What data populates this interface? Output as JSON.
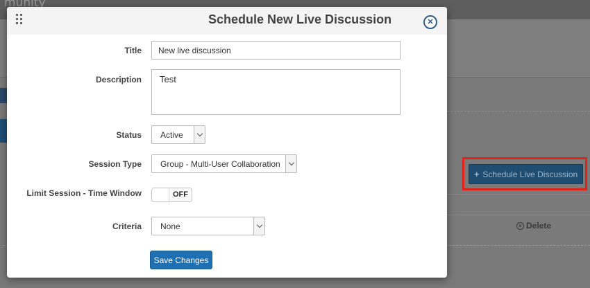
{
  "background": {
    "page_title_fragment": "munity",
    "schedule_button_label": "Schedule Live Discussion",
    "delete_label": "Delete"
  },
  "modal": {
    "title": "Schedule New Live Discussion",
    "fields": {
      "title_label": "Title",
      "title_value": "New live discussion",
      "description_label": "Description",
      "description_value": "Test",
      "status_label": "Status",
      "status_value": "Active",
      "session_type_label": "Session Type",
      "session_type_value": "Group - Multi-User Collaboration",
      "limit_label": "Limit Session - Time Window",
      "limit_toggle_text": "OFF",
      "criteria_label": "Criteria",
      "criteria_value": "None"
    },
    "save_label": "Save Changes"
  },
  "colors": {
    "primary": "#1f6fb3",
    "highlight": "#e2231a",
    "close_icon": "#2c5b8a"
  }
}
